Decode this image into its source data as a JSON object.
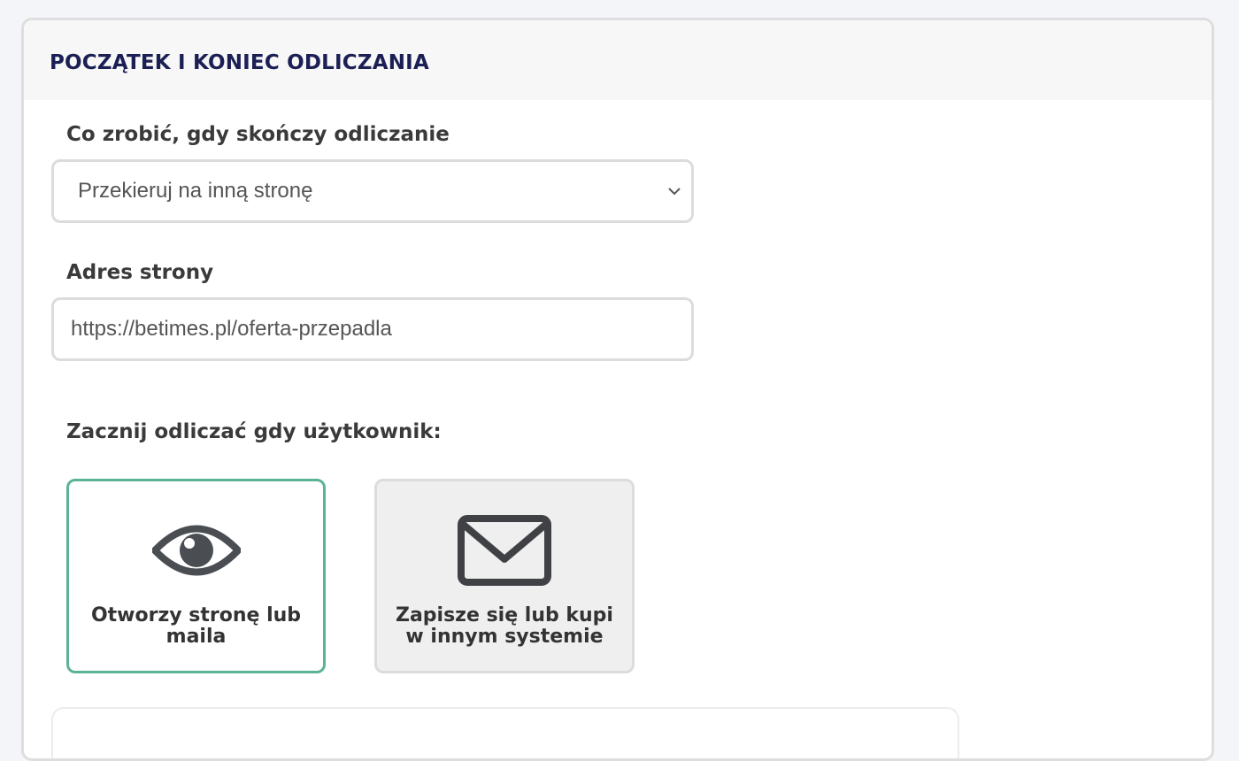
{
  "section": {
    "title": "POCZĄTEK I KONIEC ODLICZANIA"
  },
  "end_action": {
    "label": "Co zrobić, gdy skończy odliczanie",
    "selected": "Przekieruj na inną stronę",
    "icon": "chevron-down-icon"
  },
  "page_address": {
    "label": "Adres strony",
    "value": "https://betimes.pl/oferta-przepadla"
  },
  "start_trigger": {
    "label": "Zacznij odliczać gdy użytkownik:",
    "options": [
      {
        "label": "Otworzy stronę lub maila",
        "icon": "eye-icon",
        "selected": true
      },
      {
        "label": "Zapisze się lub kupi w innym systemie",
        "icon": "envelope-icon",
        "selected": false
      }
    ]
  },
  "colors": {
    "title": "#1b1f54",
    "selected_border": "#5bb397",
    "icon": "#4a4d52"
  }
}
